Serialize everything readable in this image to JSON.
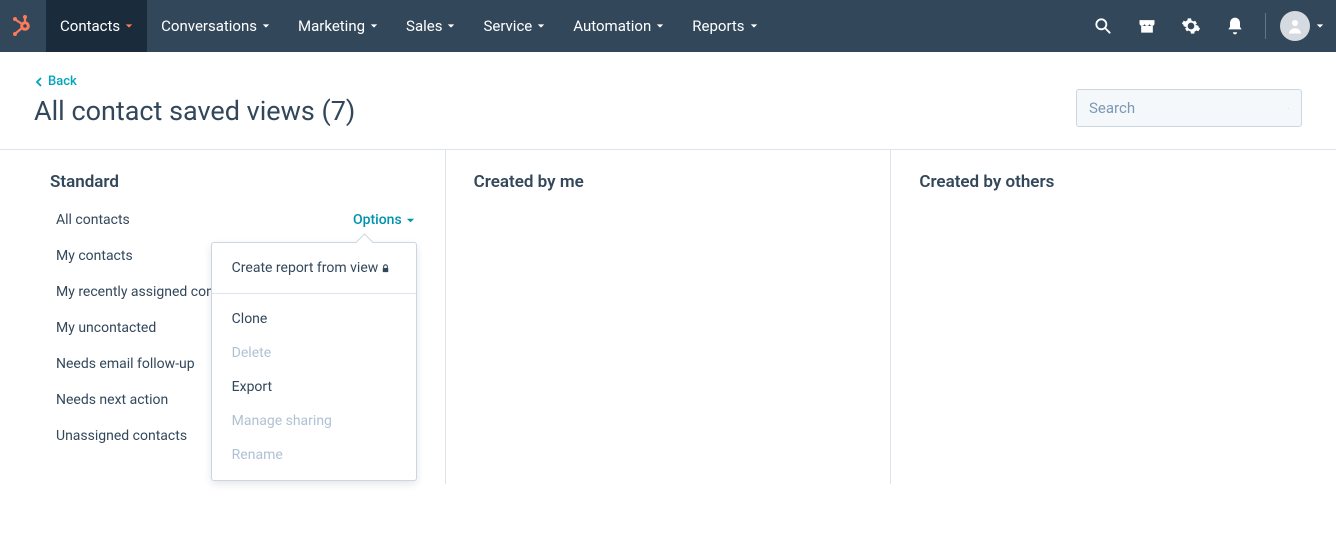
{
  "nav": {
    "items": [
      {
        "label": "Contacts",
        "active": true
      },
      {
        "label": "Conversations"
      },
      {
        "label": "Marketing"
      },
      {
        "label": "Sales"
      },
      {
        "label": "Service"
      },
      {
        "label": "Automation"
      },
      {
        "label": "Reports"
      }
    ]
  },
  "back_label": "Back",
  "page_title": "All contact saved views (7)",
  "search_placeholder": "Search",
  "columns": {
    "standard": {
      "header": "Standard",
      "views": [
        "All contacts",
        "My contacts",
        "My recently assigned contacts",
        "My uncontacted",
        "Needs email follow-up",
        "Needs next action",
        "Unassigned contacts"
      ],
      "options_label": "Options"
    },
    "created_by_me": {
      "header": "Created by me"
    },
    "created_by_others": {
      "header": "Created by others"
    }
  },
  "dropdown": {
    "top": [
      {
        "label": "Create report from view",
        "locked": true
      }
    ],
    "main": [
      {
        "label": "Clone"
      },
      {
        "label": "Delete",
        "disabled": true
      },
      {
        "label": "Export"
      },
      {
        "label": "Manage sharing",
        "disabled": true
      },
      {
        "label": "Rename",
        "disabled": true
      }
    ]
  }
}
